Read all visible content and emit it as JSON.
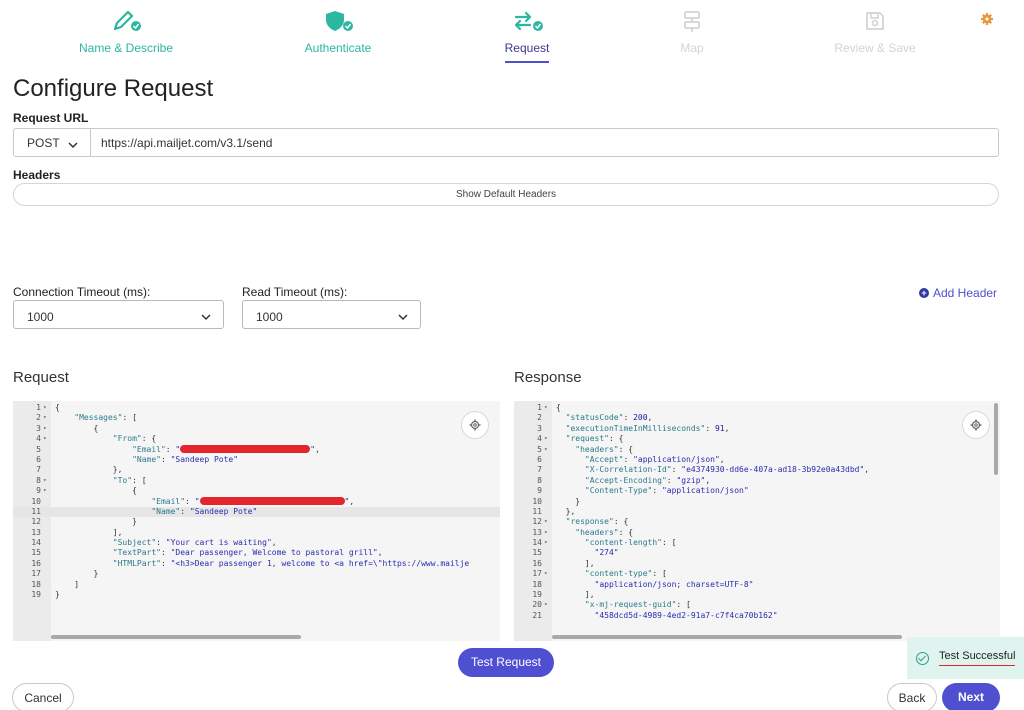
{
  "stepper": {
    "steps": [
      {
        "label": "Name & Describe",
        "state": "done"
      },
      {
        "label": "Authenticate",
        "state": "done"
      },
      {
        "label": "Request",
        "state": "active"
      },
      {
        "label": "Map",
        "state": "disabled"
      },
      {
        "label": "Review & Save",
        "state": "disabled"
      }
    ],
    "accent": "#2bb7a0"
  },
  "page": {
    "title": "Configure Request"
  },
  "request_url": {
    "label": "Request URL",
    "method": "POST",
    "url": "https://api.mailjet.com/v3.1/send"
  },
  "headers": {
    "label": "Headers",
    "show_default": "Show Default Headers",
    "add_header": "Add Header"
  },
  "timeouts": {
    "connection_label": "Connection Timeout (ms):",
    "connection_value": "1000",
    "read_label": "Read Timeout (ms):",
    "read_value": "1000"
  },
  "request_panel": {
    "title": "Request",
    "lines": [
      {
        "n": "1",
        "fold": true,
        "html": "{"
      },
      {
        "n": "2",
        "fold": true,
        "html": "    <span class=\"k\">\"Messages\"</span>: ["
      },
      {
        "n": "3",
        "fold": true,
        "html": "        {"
      },
      {
        "n": "4",
        "fold": true,
        "html": "            <span class=\"k\">\"From\"</span>: {"
      },
      {
        "n": "5",
        "fold": false,
        "html": "                <span class=\"k\">\"Email\"</span>: <span class=\"s\">\"<span class=\"redact\" style=\"width:130px\"></span>\"</span>,"
      },
      {
        "n": "6",
        "fold": false,
        "html": "                <span class=\"k\">\"Name\"</span>: <span class=\"s\">\"Sandeep Pote\"</span>"
      },
      {
        "n": "7",
        "fold": false,
        "html": "            },"
      },
      {
        "n": "8",
        "fold": true,
        "html": "            <span class=\"k\">\"To\"</span>: ["
      },
      {
        "n": "9",
        "fold": true,
        "html": "                {"
      },
      {
        "n": "10",
        "fold": false,
        "html": "                    <span class=\"k\">\"Email\"</span>: <span class=\"s\">\"<span class=\"redact\" style=\"width:145px\"></span>\"</span>,"
      },
      {
        "n": "11",
        "fold": false,
        "hl": true,
        "html": "                    <span class=\"k\">\"Name\"</span>: <span class=\"s\">\"Sandeep Pote\"</span>"
      },
      {
        "n": "12",
        "fold": false,
        "html": "                }"
      },
      {
        "n": "13",
        "fold": false,
        "html": "            ],"
      },
      {
        "n": "14",
        "fold": false,
        "html": "            <span class=\"k\">\"Subject\"</span>: <span class=\"s\">\"Your cart is waiting\"</span>,"
      },
      {
        "n": "15",
        "fold": false,
        "html": "            <span class=\"k\">\"TextPart\"</span>: <span class=\"s\">\"Dear passenger, Welcome to pastoral grill\"</span>,"
      },
      {
        "n": "16",
        "fold": false,
        "html": "            <span class=\"k\">\"HTMLPart\"</span>: <span class=\"s\">\"&lt;h3&gt;Dear passenger 1, welcome to &lt;a href=\\\"https://www.mailje</span>"
      },
      {
        "n": "17",
        "fold": false,
        "html": "        }"
      },
      {
        "n": "18",
        "fold": false,
        "html": "    ]"
      },
      {
        "n": "19",
        "fold": false,
        "html": "}"
      }
    ]
  },
  "response_panel": {
    "title": "Response",
    "lines": [
      {
        "n": "1",
        "fold": true,
        "html": "{"
      },
      {
        "n": "2",
        "fold": false,
        "html": "  <span class=\"k\">\"statusCode\"</span>: <span class=\"n\">200</span>,"
      },
      {
        "n": "3",
        "fold": false,
        "html": "  <span class=\"k\">\"executionTimeInMilliseconds\"</span>: <span class=\"n\">91</span>,"
      },
      {
        "n": "4",
        "fold": true,
        "html": "  <span class=\"k\">\"request\"</span>: {"
      },
      {
        "n": "5",
        "fold": true,
        "html": "    <span class=\"k\">\"headers\"</span>: {"
      },
      {
        "n": "6",
        "fold": false,
        "html": "      <span class=\"k\">\"Accept\"</span>: <span class=\"s\">\"application/json\"</span>,"
      },
      {
        "n": "7",
        "fold": false,
        "html": "      <span class=\"k\">\"X-Correlation-Id\"</span>: <span class=\"s\">\"e4374930-dd6e-407a-ad18-3b92e0a43dbd\"</span>,"
      },
      {
        "n": "8",
        "fold": false,
        "html": "      <span class=\"k\">\"Accept-Encoding\"</span>: <span class=\"s\">\"gzip\"</span>,"
      },
      {
        "n": "9",
        "fold": false,
        "html": "      <span class=\"k\">\"Content-Type\"</span>: <span class=\"s\">\"application/json\"</span>"
      },
      {
        "n": "10",
        "fold": false,
        "html": "    }"
      },
      {
        "n": "11",
        "fold": false,
        "html": "  },"
      },
      {
        "n": "12",
        "fold": true,
        "html": "  <span class=\"k\">\"response\"</span>: {"
      },
      {
        "n": "13",
        "fold": true,
        "html": "    <span class=\"k\">\"headers\"</span>: {"
      },
      {
        "n": "14",
        "fold": true,
        "html": "      <span class=\"k\">\"content-length\"</span>: ["
      },
      {
        "n": "15",
        "fold": false,
        "html": "        <span class=\"s\">\"274\"</span>"
      },
      {
        "n": "16",
        "fold": false,
        "html": "      ],"
      },
      {
        "n": "17",
        "fold": true,
        "html": "      <span class=\"k\">\"content-type\"</span>: ["
      },
      {
        "n": "18",
        "fold": false,
        "html": "        <span class=\"s\">\"application/json; charset=UTF-8\"</span>"
      },
      {
        "n": "19",
        "fold": false,
        "html": "      ],"
      },
      {
        "n": "20",
        "fold": true,
        "html": "      <span class=\"k\">\"x-mj-request-guid\"</span>: ["
      },
      {
        "n": "21",
        "fold": false,
        "html": "        <span class=\"s\">\"458dcd5d-4989-4ed2-91a7-c7f4ca70b162\"</span>"
      }
    ]
  },
  "buttons": {
    "test_request": "Test Request",
    "cancel": "Cancel",
    "back": "Back",
    "next": "Next"
  },
  "toast": {
    "message": "Test Successful"
  },
  "colors": {
    "primary": "#4e4fd1",
    "teal": "#2bb7a0",
    "redact": "#e3262c"
  }
}
